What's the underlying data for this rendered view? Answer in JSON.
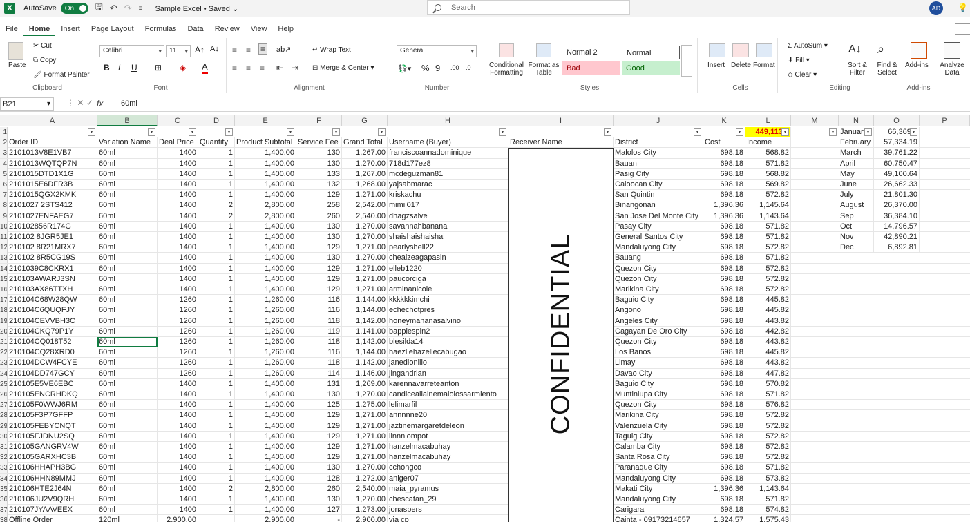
{
  "titlebar": {
    "autosave_label": "AutoSave",
    "autosave_state": "On",
    "doc_title": "Sample Excel • Saved ⌄",
    "search_placeholder": "Search",
    "avatar": "AD"
  },
  "menu": [
    "File",
    "Home",
    "Insert",
    "Page Layout",
    "Formulas",
    "Data",
    "Review",
    "View",
    "Help"
  ],
  "ribbon": {
    "clipboard": {
      "paste": "Paste",
      "cut": "Cut",
      "copy": "Copy",
      "format_painter": "Format Painter",
      "label": "Clipboard"
    },
    "font": {
      "name": "Calibri",
      "size": "11",
      "label": "Font",
      "bold": "B",
      "italic": "I",
      "underline": "U"
    },
    "alignment": {
      "wrap": "Wrap Text",
      "merge": "Merge & Center",
      "label": "Alignment"
    },
    "number": {
      "format": "General",
      "label": "Number",
      "percent": "%",
      "comma": "9"
    },
    "styles": {
      "cond": "Conditional Formatting",
      "table": "Format as Table",
      "normal2": "Normal 2",
      "normal": "Normal",
      "bad": "Bad",
      "good": "Good",
      "label": "Styles"
    },
    "cells": {
      "insert": "Insert",
      "delete": "Delete",
      "format": "Format",
      "label": "Cells"
    },
    "editing": {
      "autosum": "AutoSum",
      "fill": "Fill",
      "clear": "Clear",
      "sort": "Sort & Filter",
      "find": "Find & Select",
      "label": "Editing"
    },
    "addins": {
      "addins": "Add-ins",
      "label": "Add-ins"
    },
    "analyze": {
      "label": "Analyze Data"
    }
  },
  "formula_bar": {
    "namebox": "B21",
    "fx": "fx",
    "content": "60ml"
  },
  "columns": [
    "A",
    "B",
    "C",
    "D",
    "E",
    "F",
    "G",
    "H",
    "I",
    "J",
    "K",
    "L",
    "M",
    "N",
    "O",
    "P"
  ],
  "highlight_total": "449,113.2",
  "headers": [
    "Order ID",
    "Variation Name",
    "Deal Price",
    "Quantity",
    "Product Subtotal",
    "Service Fee",
    "Grand Total",
    "Username (Buyer)",
    "Receiver Name",
    "District",
    "Cost",
    "Income"
  ],
  "confidential": "CONFIDENTIAL",
  "rows": [
    [
      "2101013V8E1VB7",
      "60ml",
      "1400",
      "1",
      "1,400.00",
      "130",
      "1,267.00",
      "franciscoannadominique",
      "Malolos City",
      "698.18",
      "568.82"
    ],
    [
      "2101013WQTQP7N",
      "60ml",
      "1400",
      "1",
      "1,400.00",
      "130",
      "1,270.00",
      "718d177ez8",
      "Bauan",
      "698.18",
      "571.82"
    ],
    [
      "2101015DTD1X1G",
      "60ml",
      "1400",
      "1",
      "1,400.00",
      "133",
      "1,267.00",
      "mcdeguzman81",
      "Pasig City",
      "698.18",
      "568.82"
    ],
    [
      "2101015E6DFR3B",
      "60ml",
      "1400",
      "1",
      "1,400.00",
      "132",
      "1,268.00",
      "yajsabmarac",
      "Caloocan City",
      "698.18",
      "569.82"
    ],
    [
      "2101015QGX2KMK",
      "60ml",
      "1400",
      "1",
      "1,400.00",
      "129",
      "1,271.00",
      "kriskachu",
      "San Quintin",
      "698.18",
      "572.82"
    ],
    [
      "2101027 2STS412",
      "60ml",
      "1400",
      "2",
      "2,800.00",
      "258",
      "2,542.00",
      "mimii017",
      "Binangonan",
      "1,396.36",
      "1,145.64"
    ],
    [
      "2101027ENFAEG7",
      "60ml",
      "1400",
      "2",
      "2,800.00",
      "260",
      "2,540.00",
      "dhagzsalve",
      "San Jose Del Monte City",
      "1,396.36",
      "1,143.64"
    ],
    [
      "210102856R174G",
      "60ml",
      "1400",
      "1",
      "1,400.00",
      "130",
      "1,270.00",
      "savannahbanana",
      "Pasay City",
      "698.18",
      "571.82"
    ],
    [
      "210102 8JGR5JE1",
      "60ml",
      "1400",
      "1",
      "1,400.00",
      "130",
      "1,270.00",
      "shaishaishaishai",
      "General Santos City",
      "698.18",
      "571.82"
    ],
    [
      "210102 8R21MRX7",
      "60ml",
      "1400",
      "1",
      "1,400.00",
      "129",
      "1,271.00",
      "pearlyshell22",
      "Mandaluyong City",
      "698.18",
      "572.82"
    ],
    [
      "210102 8R5CG19S",
      "60ml",
      "1400",
      "1",
      "1,400.00",
      "130",
      "1,270.00",
      "chealzeagapasin",
      "Bauang",
      "698.18",
      "571.82"
    ],
    [
      "2101039C8CKRX1",
      "60ml",
      "1400",
      "1",
      "1,400.00",
      "129",
      "1,271.00",
      "elleb1220",
      "Quezon City",
      "698.18",
      "572.82"
    ],
    [
      "210103AWARJ3SN",
      "60ml",
      "1400",
      "1",
      "1,400.00",
      "129",
      "1,271.00",
      "paucorciga",
      "Quezon City",
      "698.18",
      "572.82"
    ],
    [
      "210103AX86TTXH",
      "60ml",
      "1400",
      "1",
      "1,400.00",
      "129",
      "1,271.00",
      "arminanicole",
      "Marikina City",
      "698.18",
      "572.82"
    ],
    [
      "210104C68W28QW",
      "60ml",
      "1260",
      "1",
      "1,260.00",
      "116",
      "1,144.00",
      "kkkkkkimchi",
      "Baguio City",
      "698.18",
      "445.82"
    ],
    [
      "210104C6QUQFJY",
      "60ml",
      "1260",
      "1",
      "1,260.00",
      "116",
      "1,144.00",
      "echechotpres",
      "Angono",
      "698.18",
      "445.82"
    ],
    [
      "210104CEVVBH3C",
      "60ml",
      "1260",
      "1",
      "1,260.00",
      "118",
      "1,142.00",
      "honeymananasalvino",
      "Angeles City",
      "698.18",
      "443.82"
    ],
    [
      "210104CKQ79P1Y",
      "60ml",
      "1260",
      "1",
      "1,260.00",
      "119",
      "1,141.00",
      "bapplespin2",
      "Cagayan De Oro City",
      "698.18",
      "442.82"
    ],
    [
      "210104CQ018T52",
      "60ml",
      "1260",
      "1",
      "1,260.00",
      "118",
      "1,142.00",
      "blesilda14",
      "Quezon City",
      "698.18",
      "443.82"
    ],
    [
      "210104CQ28XRD0",
      "60ml",
      "1260",
      "1",
      "1,260.00",
      "116",
      "1,144.00",
      "haezllehazellecabugao",
      "Los Banos",
      "698.18",
      "445.82"
    ],
    [
      "210104DCW4FCYE",
      "60ml",
      "1260",
      "1",
      "1,260.00",
      "118",
      "1,142.00",
      "janedionillo",
      "Limay",
      "698.18",
      "443.82"
    ],
    [
      "210104DD747GCY",
      "60ml",
      "1260",
      "1",
      "1,260.00",
      "114",
      "1,146.00",
      "jingandrian",
      "Davao City",
      "698.18",
      "447.82"
    ],
    [
      "210105E5VE6EBC",
      "60ml",
      "1400",
      "1",
      "1,400.00",
      "131",
      "1,269.00",
      "karennavarreteanton",
      "Baguio City",
      "698.18",
      "570.82"
    ],
    [
      "210105ENCRHDKQ",
      "60ml",
      "1400",
      "1",
      "1,400.00",
      "130",
      "1,270.00",
      "candiceallainemalolossarmiento",
      "Muntinlupa City",
      "698.18",
      "571.82"
    ],
    [
      "210105F0WWJ6RM",
      "60ml",
      "1400",
      "1",
      "1,400.00",
      "125",
      "1,275.00",
      "lelimarfil",
      "Quezon City",
      "698.18",
      "576.82"
    ],
    [
      "210105F3P7GFFP",
      "60ml",
      "1400",
      "1",
      "1,400.00",
      "129",
      "1,271.00",
      "annnnne20",
      "Marikina City",
      "698.18",
      "572.82"
    ],
    [
      "210105FEBYCNQT",
      "60ml",
      "1400",
      "1",
      "1,400.00",
      "129",
      "1,271.00",
      "jaztinemargaretdeleon",
      "Valenzuela City",
      "698.18",
      "572.82"
    ],
    [
      "210105FJDNU2SQ",
      "60ml",
      "1400",
      "1",
      "1,400.00",
      "129",
      "1,271.00",
      "linnnlompot",
      "Taguig City",
      "698.18",
      "572.82"
    ],
    [
      "210105GANGRV4W",
      "60ml",
      "1400",
      "1",
      "1,400.00",
      "129",
      "1,271.00",
      "hanzelmacabuhay",
      "Calamba City",
      "698.18",
      "572.82"
    ],
    [
      "210105GARXHC3B",
      "60ml",
      "1400",
      "1",
      "1,400.00",
      "129",
      "1,271.00",
      "hanzelmacabuhay",
      "Santa Rosa City",
      "698.18",
      "572.82"
    ],
    [
      "210106HHAPH3BG",
      "60ml",
      "1400",
      "1",
      "1,400.00",
      "130",
      "1,270.00",
      "cchongco",
      "Paranaque City",
      "698.18",
      "571.82"
    ],
    [
      "210106HHN89MMJ",
      "60ml",
      "1400",
      "1",
      "1,400.00",
      "128",
      "1,272.00",
      "aniger07",
      "Mandaluyong City",
      "698.18",
      "573.82"
    ],
    [
      "210106HTE2J64N",
      "60ml",
      "1400",
      "2",
      "2,800.00",
      "260",
      "2,540.00",
      "maia_pyramus",
      "Makati City",
      "1,396.36",
      "1,143.64"
    ],
    [
      "210106JU2V9QRH",
      "60ml",
      "1400",
      "1",
      "1,400.00",
      "130",
      "1,270.00",
      "chescatan_29",
      "Mandaluyong City",
      "698.18",
      "571.82"
    ],
    [
      "210107JYAAVEEX",
      "60ml",
      "1400",
      "1",
      "1,400.00",
      "127",
      "1,273.00",
      "jonasbers",
      "Carigara",
      "698.18",
      "574.82"
    ],
    [
      "Offline Order",
      "120ml",
      "2,900.00",
      "",
      "2,900.00",
      "-",
      "2,900.00",
      "via cp",
      "Cainta - 09173214657",
      "1,324.57",
      "1,575.43"
    ]
  ],
  "months": [
    [
      "January",
      "66,369.5"
    ],
    [
      "February",
      "57,334.19"
    ],
    [
      "March",
      "39,761.22"
    ],
    [
      "April",
      "60,750.47"
    ],
    [
      "May",
      "49,100.64"
    ],
    [
      "June",
      "26,662.33"
    ],
    [
      "July",
      "21,801.30"
    ],
    [
      "August",
      "26,370.00"
    ],
    [
      "Sep",
      "36,384.10"
    ],
    [
      "Oct",
      "14,796.57"
    ],
    [
      "Nov",
      "42,890.21"
    ],
    [
      "Dec",
      "6,892.81"
    ]
  ]
}
